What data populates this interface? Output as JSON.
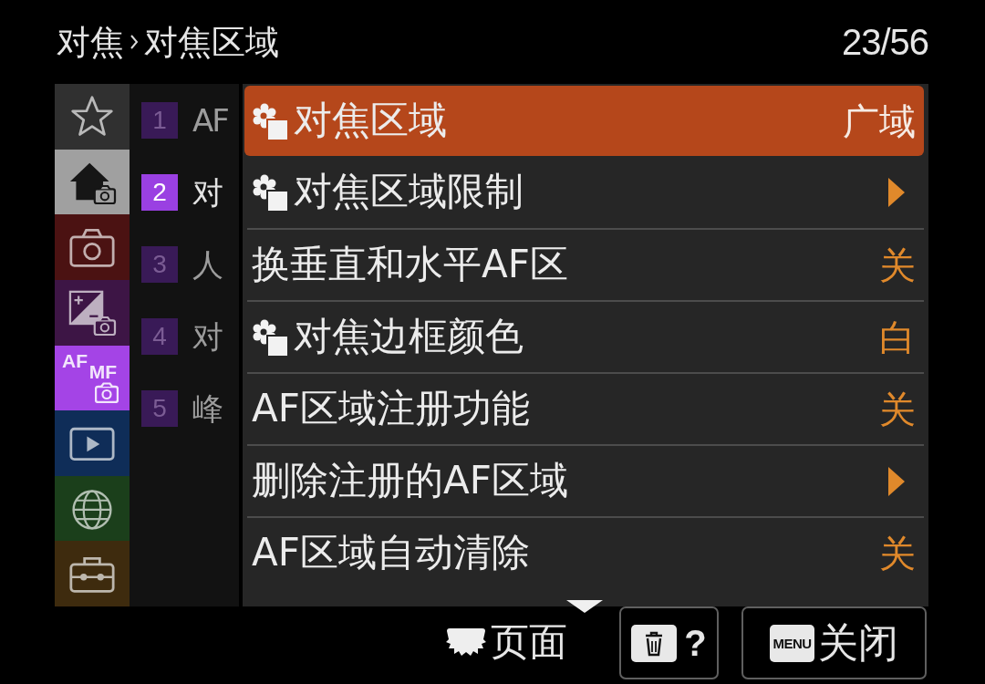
{
  "header": {
    "breadcrumb": [
      "对焦",
      "对焦区域"
    ],
    "page_counter": "23/56"
  },
  "tabs": [
    {
      "color": "#303030",
      "selected": false
    },
    {
      "color": "#a0a0a0",
      "selected": false
    },
    {
      "color": "#4b1212",
      "selected": false
    },
    {
      "color": "#3d1545",
      "selected": false
    },
    {
      "color": "#a444e6",
      "selected": true,
      "label_main": "AF",
      "label_sub": "MF"
    },
    {
      "color": "#0f2d58",
      "selected": false
    },
    {
      "color": "#1b3f1b",
      "selected": false
    },
    {
      "color": "#3e2b0e",
      "selected": false
    }
  ],
  "pages": [
    {
      "number": "1",
      "label": "AF",
      "selected": false
    },
    {
      "number": "2",
      "label": "对",
      "selected": true
    },
    {
      "number": "3",
      "label": "人",
      "selected": false
    },
    {
      "number": "4",
      "label": "对",
      "selected": false
    },
    {
      "number": "5",
      "label": "峰",
      "selected": false
    }
  ],
  "items": [
    {
      "label": "对焦区域",
      "prefix_icon": true,
      "kind": "value",
      "value": "广域",
      "selected": true
    },
    {
      "label": "对焦区域限制",
      "prefix_icon": true,
      "kind": "submenu",
      "selected": false
    },
    {
      "label": "换垂直和水平AF区",
      "prefix_icon": false,
      "kind": "value",
      "value": "关",
      "selected": false
    },
    {
      "label": "对焦边框颜色",
      "prefix_icon": true,
      "kind": "value",
      "value": "白",
      "selected": false
    },
    {
      "label": "AF区域注册功能",
      "prefix_icon": false,
      "kind": "value",
      "value": "关",
      "selected": false
    },
    {
      "label": "删除注册的AF区域",
      "prefix_icon": false,
      "kind": "submenu",
      "selected": false
    },
    {
      "label": "AF区域自动清除",
      "prefix_icon": false,
      "kind": "value",
      "value": "关",
      "selected": false
    }
  ],
  "footer": {
    "page_hint": "页面",
    "help_button": {
      "label": "?"
    },
    "close_button": {
      "key": "MENU",
      "label": "关闭"
    }
  }
}
